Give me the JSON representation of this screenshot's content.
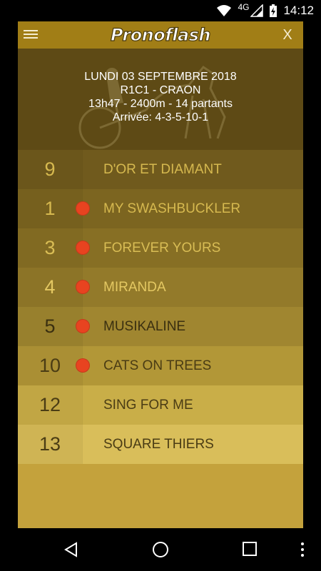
{
  "status_bar": {
    "network": "4G",
    "time": "14:12"
  },
  "app": {
    "title": "Pronoflash",
    "close_label": "X"
  },
  "race": {
    "date": "LUNDI 03 SEPTEMBRE 2018",
    "code": "R1C1 - CRAON",
    "details": "13h47 - 2400m - 14 partants",
    "arrival": "Arrivée: 4-3-5-10-1"
  },
  "runners": [
    {
      "number": "9",
      "name": "D'OR ET DIAMANT",
      "selected": false,
      "row_color": "#705a1d",
      "num_bg": "#6b561b",
      "text_color": "#d6b94f",
      "num_color": "#d6b94f"
    },
    {
      "number": "1",
      "name": "MY SWASHBUCKLER",
      "selected": true,
      "row_color": "#7c6520",
      "num_bg": "#76601e",
      "text_color": "#d6b94f",
      "num_color": "#d6b94f"
    },
    {
      "number": "3",
      "name": "FOREVER YOURS",
      "selected": true,
      "row_color": "#876f24",
      "num_bg": "#816a22",
      "text_color": "#d9bd55",
      "num_color": "#d9bd55"
    },
    {
      "number": "4",
      "name": "MIRANDA",
      "selected": true,
      "row_color": "#937a2a",
      "num_bg": "#8c7427",
      "text_color": "#e4c862",
      "num_color": "#e4c862"
    },
    {
      "number": "5",
      "name": "MUSIKALINE",
      "selected": true,
      "row_color": "#a08630",
      "num_bg": "#98802d",
      "text_color": "#3a2f10",
      "num_color": "#3a2f10"
    },
    {
      "number": "10",
      "name": "CATS ON TREES",
      "selected": true,
      "row_color": "#b29737",
      "num_bg": "#aa8f34",
      "text_color": "#4a3c14",
      "num_color": "#4a3c14"
    },
    {
      "number": "12",
      "name": "SING FOR ME",
      "selected": false,
      "row_color": "#c9ae48",
      "num_bg": "#c1a644",
      "text_color": "#4a3c14",
      "num_color": "#4a3c14"
    },
    {
      "number": "13",
      "name": "SQUARE THIERS",
      "selected": false,
      "row_color": "#d9be5a",
      "num_bg": "#cfb454",
      "text_color": "#4a3c14",
      "num_color": "#4a3c14"
    }
  ]
}
